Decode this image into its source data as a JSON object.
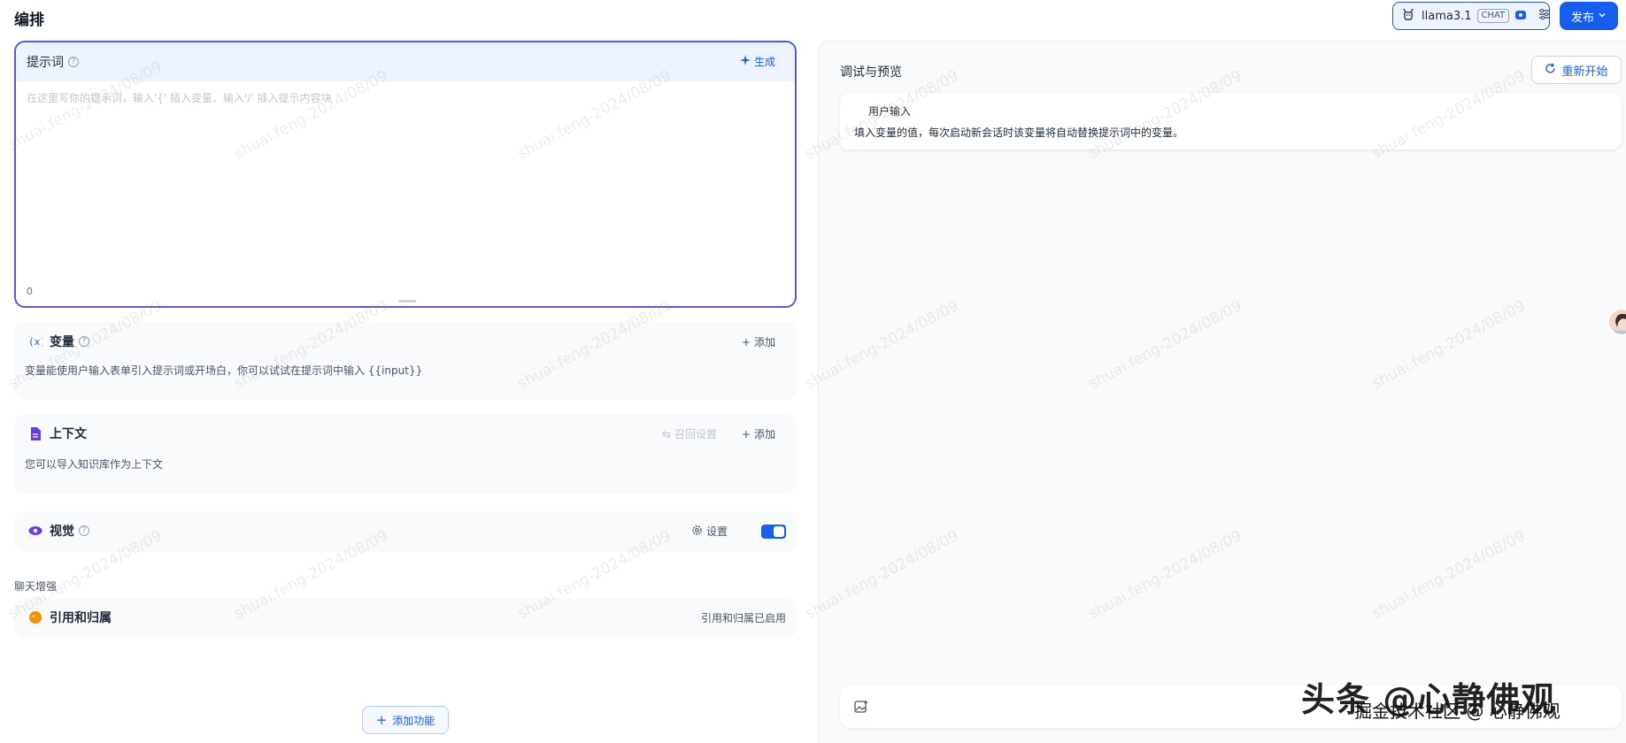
{
  "header": {
    "title": "编排",
    "model_name": "llama3.1",
    "model_badge": "CHAT",
    "publish_label": "发布"
  },
  "prompt": {
    "label": "提示词",
    "generate_label": "生成",
    "placeholder": "在这里写你的提示词，输入'{' 插入变量、输入'/' 插入提示内容块",
    "char_count": "0"
  },
  "variables": {
    "title": "变量",
    "add_label": "添加",
    "description": "变量能使用户输入表单引入提示词或开场白，你可以试试在提示词中输入 {{input}}"
  },
  "context": {
    "title": "上下文",
    "retrieval_label": "召回设置",
    "add_label": "添加",
    "description": "您可以导入知识库作为上下文"
  },
  "vision": {
    "title": "视觉",
    "settings_label": "设置",
    "enabled": true
  },
  "chat_enhance": {
    "section_label": "聊天增强",
    "citation_title": "引用和归属",
    "citation_status": "引用和归属已启用"
  },
  "add_feature_label": "添加功能",
  "preview": {
    "title": "调试与预览",
    "restart_label": "重新开始",
    "user_input_title": "用户输入",
    "user_input_desc": "填入变量的值，每次启动新会话时该变量将自动替换提示词中的变量。"
  },
  "watermark_text": "shuai.feng-2024/08/09",
  "overlay": {
    "brand_large": "头条 @心静佛观",
    "brand_small": "掘金技术社区 @ 心静佛观"
  },
  "colors": {
    "primary": "#155eef",
    "accent_border": "#5b55e0",
    "variable_icon": "#155eef",
    "context_icon": "#6938ef",
    "vision_icon": "#6938ef",
    "citation_icon": "#f79009"
  }
}
